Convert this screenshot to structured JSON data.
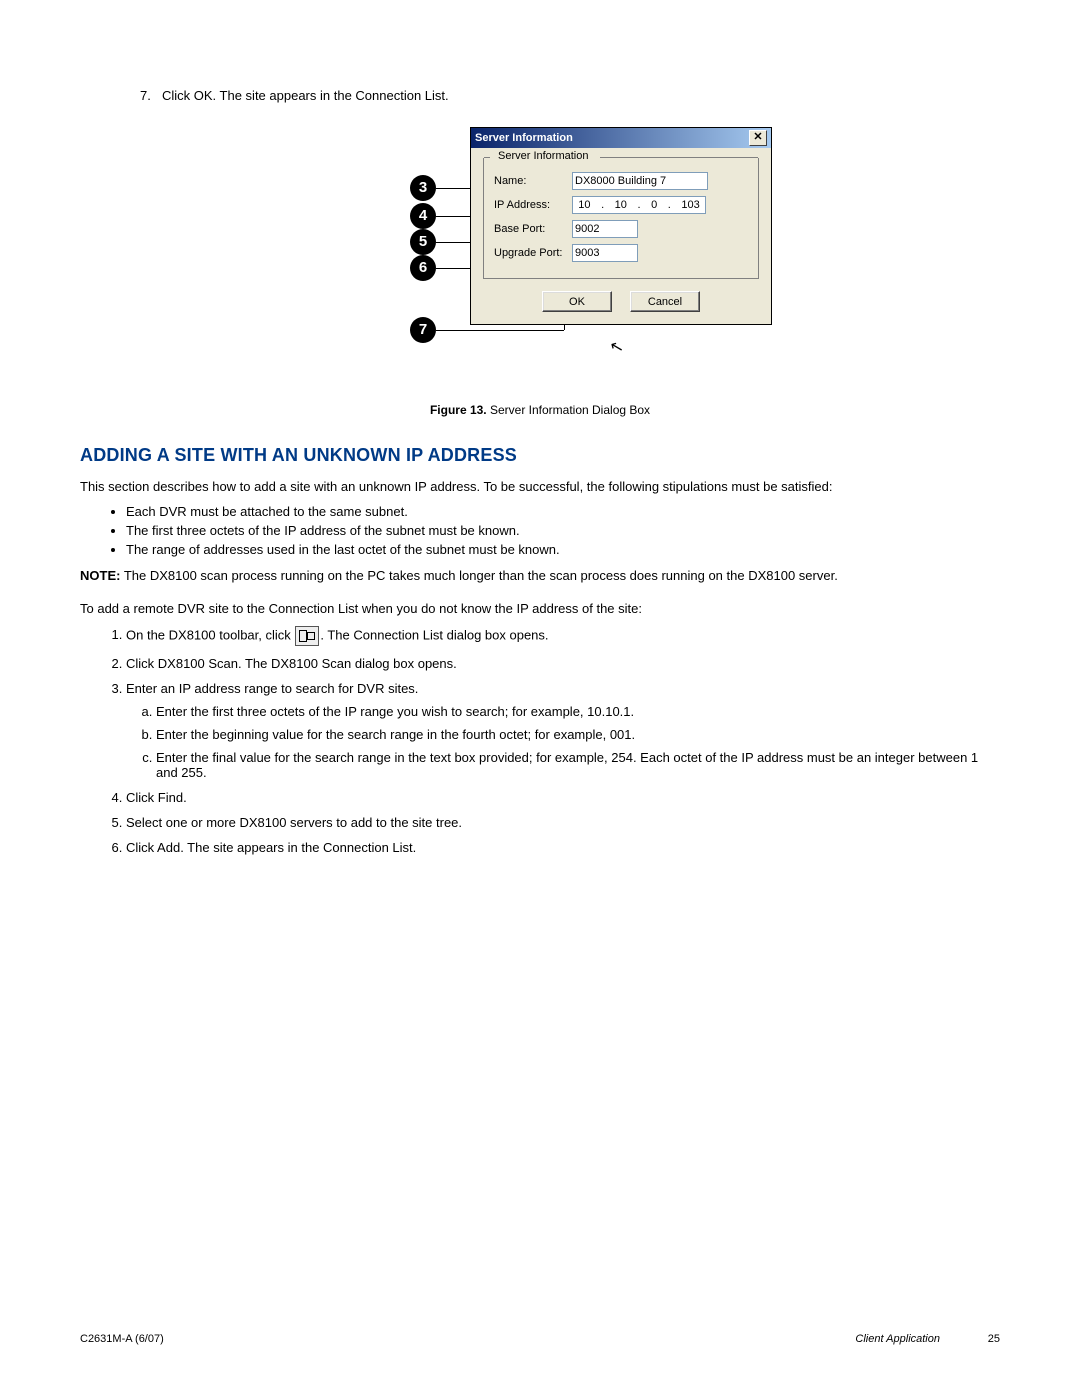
{
  "step7": {
    "num": "7.",
    "text": "Click OK. The site appears in the Connection List."
  },
  "dialog": {
    "title": "Server Information",
    "legend": "Server Information",
    "name_label": "Name:",
    "name_value": "DX8000 Building 7",
    "ip_label": "IP Address:",
    "ip": {
      "o1": "10",
      "o2": "10",
      "o3": "0",
      "o4": "103"
    },
    "base_label": "Base Port:",
    "base_value": "9002",
    "upg_label": "Upgrade Port:",
    "upg_value": "9003",
    "ok": "OK",
    "cancel": "Cancel"
  },
  "callouts": {
    "c3": "3",
    "c4": "4",
    "c5": "5",
    "c6": "6",
    "c7": "7"
  },
  "caption": {
    "b": "Figure 13.",
    "t": "  Server Information Dialog Box"
  },
  "sec_title": "ADDING A SITE WITH AN UNKNOWN IP ADDRESS",
  "intro": "This section describes how to add a site with an unknown IP address. To be successful, the following stipulations must be satisfied:",
  "bul": {
    "b1": "Each DVR must be attached to the same subnet.",
    "b2": "The first three octets of the IP address of the subnet must be known.",
    "b3": "The range of addresses used in the last octet of the subnet must be known."
  },
  "note": {
    "label": "NOTE:",
    "text": "  The DX8100 scan process running on the PC takes much longer than the scan process does running on the DX8100 server."
  },
  "lead": "To add a remote DVR site to the Connection List when you do not know the IP address of the site:",
  "s1": {
    "a": "On the DX8100 toolbar, click ",
    "b": ". The Connection List dialog box opens."
  },
  "s2": "Click DX8100 Scan. The DX8100 Scan dialog box opens.",
  "s3": "Enter an IP address range to search for DVR sites.",
  "s3a": "Enter the first three octets of the IP range you wish to search; for example, 10.10.1.",
  "s3b": "Enter the beginning value for the search range in the fourth octet; for example, 001.",
  "s3c": "Enter the final value for the search range in the text box provided; for example, 254. Each octet of the IP address must be an integer between 1 and 255.",
  "s4": "Click Find.",
  "s5": "Select one or more DX8100 servers to add to the site tree.",
  "s6": "Click Add. The site appears in the Connection List.",
  "footer": {
    "left": "C2631M-A (6/07)",
    "mid": "Client Application",
    "right": "25"
  }
}
